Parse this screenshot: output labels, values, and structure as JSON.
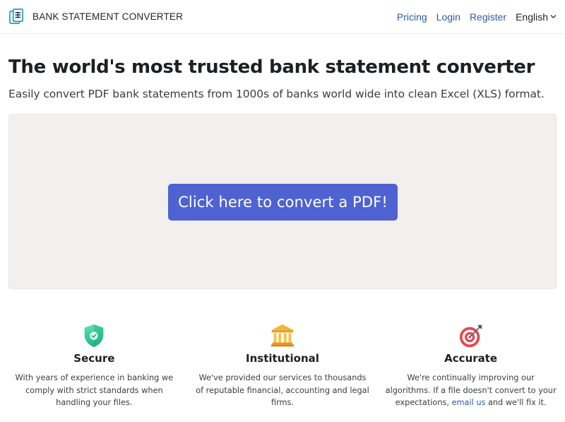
{
  "header": {
    "brand": "BANK STATEMENT CONVERTER",
    "nav": {
      "pricing": "Pricing",
      "login": "Login",
      "register": "Register",
      "language": "English"
    }
  },
  "hero": {
    "title": "The world's most trusted bank statement converter",
    "subtitle": "Easily convert PDF bank statements from 1000s of banks world wide into clean Excel (XLS) format."
  },
  "upload": {
    "button_label": "Click here to convert a PDF!"
  },
  "features": [
    {
      "icon": "shield-check-icon",
      "title": "Secure",
      "description": "With years of experience in banking we comply with strict standards when handling your files."
    },
    {
      "icon": "bank-building-icon",
      "title": "Institutional",
      "description": "We've provided our services to thousands of reputable financial, accounting and legal firms."
    },
    {
      "icon": "target-dart-icon",
      "title": "Accurate",
      "description_before": "We're continually improving our algorithms. If a file doesn't convert to your expectations,",
      "link_text": "email us",
      "description_after": "and we'll fix it."
    }
  ],
  "colors": {
    "accent": "#4f62d2",
    "link": "#2f5aa0",
    "drop_zone_bg": "#f1f0ef"
  }
}
